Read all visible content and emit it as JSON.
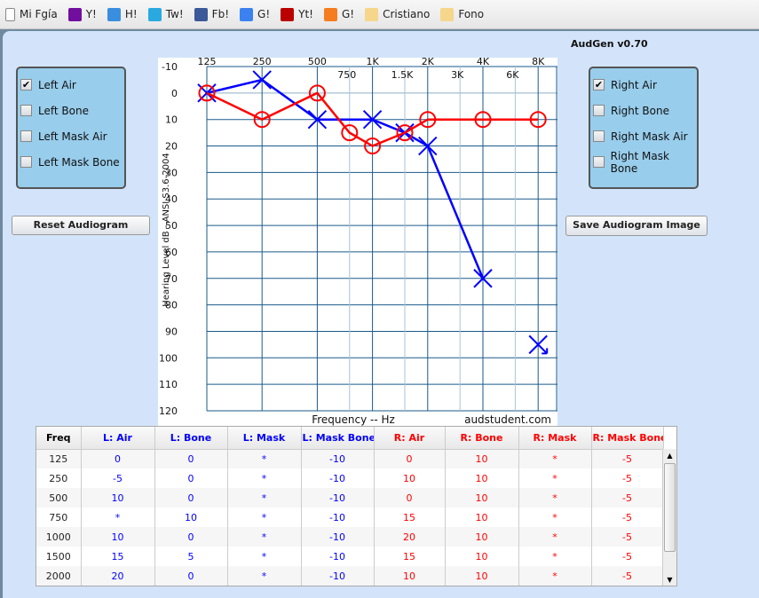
{
  "bookmarks": [
    {
      "label": "Mi Fgía",
      "icon": "page-icon",
      "color": "#ffffff"
    },
    {
      "label": "Y!",
      "icon": "yahoo-icon",
      "color": "#720e9e"
    },
    {
      "label": "H!",
      "icon": "windows-icon",
      "color": "#3a8ee0"
    },
    {
      "label": "Tw!",
      "icon": "twitter-icon",
      "color": "#2aa9e0"
    },
    {
      "label": "Fb!",
      "icon": "facebook-icon",
      "color": "#3b5998"
    },
    {
      "label": "G!",
      "icon": "google-icon",
      "color": "#3b82f0"
    },
    {
      "label": "Yt!",
      "icon": "youtube-icon",
      "color": "#b00"
    },
    {
      "label": "G!",
      "icon": "grooveshark-icon",
      "color": "#f57d20"
    },
    {
      "label": "Cristiano",
      "icon": "folder-icon",
      "color": "#f5d68a"
    },
    {
      "label": "Fono",
      "icon": "folder-icon",
      "color": "#f5d68a"
    }
  ],
  "app": {
    "title": "AudGen v0.70",
    "reset_label": "Reset Audiogram",
    "save_label": "Save Audiogram Image"
  },
  "left_panel": [
    {
      "label": "Left Air",
      "checked": true
    },
    {
      "label": "Left Bone",
      "checked": false
    },
    {
      "label": "Left Mask Air",
      "checked": false
    },
    {
      "label": "Left Mask Bone",
      "checked": false
    }
  ],
  "right_panel": [
    {
      "label": "Right Air",
      "checked": true
    },
    {
      "label": "Right Bone",
      "checked": false
    },
    {
      "label": "Right Mask Air",
      "checked": false
    },
    {
      "label": "Right Mask Bone",
      "checked": false
    }
  ],
  "chart_data": {
    "type": "line",
    "xlabel": "Frequency -- Hz",
    "ylabel": "Hearing Level dB - ANSI S3.6-2004",
    "credit": "audstudent.com",
    "x_ticks_top": [
      "125",
      "250",
      "500",
      "1K",
      "2K",
      "4K",
      "8K"
    ],
    "x_ticks_mid": [
      "750",
      "1.5K",
      "3K",
      "6K"
    ],
    "y_ticks": [
      -10,
      0,
      10,
      20,
      30,
      40,
      50,
      60,
      70,
      80,
      90,
      100,
      110,
      120
    ],
    "ylim": [
      -10,
      120
    ],
    "y_inverted": true,
    "x_scale": "log2",
    "grid": true,
    "series": [
      {
        "name": "Left Air",
        "color": "#0000ff",
        "marker": "x",
        "points": [
          [
            125,
            0
          ],
          [
            250,
            -5
          ],
          [
            500,
            10
          ],
          [
            1000,
            10
          ],
          [
            1500,
            15
          ],
          [
            2000,
            20
          ],
          [
            4000,
            70
          ]
        ],
        "no_response": [
          [
            8000,
            95
          ]
        ]
      },
      {
        "name": "Right Air",
        "color": "#ff0000",
        "marker": "o",
        "points": [
          [
            125,
            0
          ],
          [
            250,
            10
          ],
          [
            500,
            0
          ],
          [
            750,
            15
          ],
          [
            1000,
            20
          ],
          [
            1500,
            15
          ],
          [
            2000,
            10
          ],
          [
            4000,
            10
          ],
          [
            8000,
            10
          ]
        ]
      }
    ]
  },
  "table": {
    "headers": [
      {
        "label": "Freq",
        "color": "#000"
      },
      {
        "label": "L: Air",
        "color": "#0000ff"
      },
      {
        "label": "L: Bone",
        "color": "#0000ff"
      },
      {
        "label": "L: Mask",
        "color": "#0000ff"
      },
      {
        "label": "L: Mask Bone",
        "color": "#0000ff"
      },
      {
        "label": "R: Air",
        "color": "#ff0000"
      },
      {
        "label": "R: Bone",
        "color": "#ff0000"
      },
      {
        "label": "R: Mask",
        "color": "#ff0000"
      },
      {
        "label": "R: Mask Bone",
        "color": "#ff0000"
      }
    ],
    "rows": [
      [
        "125",
        "0",
        "0",
        "*",
        "-10",
        "0",
        "10",
        "*",
        "-5"
      ],
      [
        "250",
        "-5",
        "0",
        "*",
        "-10",
        "10",
        "10",
        "*",
        "-5"
      ],
      [
        "500",
        "10",
        "0",
        "*",
        "-10",
        "0",
        "10",
        "*",
        "-5"
      ],
      [
        "750",
        "*",
        "10",
        "*",
        "-10",
        "15",
        "10",
        "*",
        "-5"
      ],
      [
        "1000",
        "10",
        "0",
        "*",
        "-10",
        "20",
        "10",
        "*",
        "-5"
      ],
      [
        "1500",
        "15",
        "5",
        "*",
        "-10",
        "15",
        "10",
        "*",
        "-5"
      ],
      [
        "2000",
        "20",
        "0",
        "*",
        "-10",
        "10",
        "10",
        "*",
        "-5"
      ]
    ]
  }
}
